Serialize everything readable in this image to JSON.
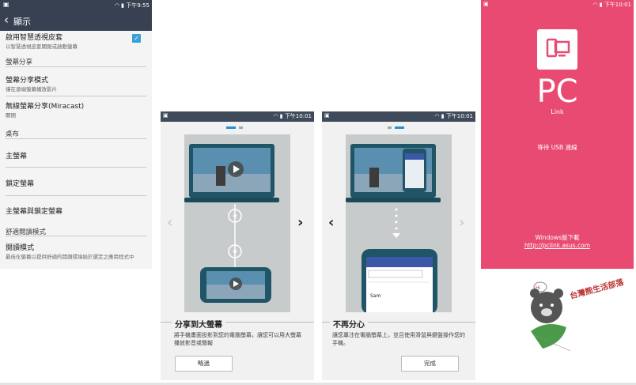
{
  "settings": {
    "status_time": "下午9:55",
    "title": "顯示",
    "smart_cover_title": "啟用智慧透視皮套",
    "smart_cover_sub": "以智慧透視皮套關閉或啟動螢幕",
    "section_share": "螢幕分享",
    "share_mode_title": "螢幕分享模式",
    "share_mode_sub": "僅在遠端螢幕播放影片",
    "miracast_title": "無線螢幕分享(Miracast)",
    "miracast_sub": "關閉",
    "section_wallpaper": "桌布",
    "home_screen": "主螢幕",
    "lock_screen": "鎖定螢幕",
    "home_and_lock": "主螢幕與鎖定螢幕",
    "section_reading": "舒適閱讀模式",
    "reading_title": "閱讀模式",
    "reading_sub": "最佳化螢幕以提供舒適的閱讀環境給於選定之應用程式中"
  },
  "onboard1": {
    "status_time": "下午10:01",
    "heading": "分享到大螢幕",
    "body": "將手機畫面投影到您的電腦螢幕，讓您可以用大螢幕播放影音或簡報",
    "button": "略過"
  },
  "onboard2": {
    "status_time": "下午10:01",
    "heading": "不再分心",
    "body": "讓您專注在電腦螢幕上，並且使用滑鼠與鍵盤操作您的手機。",
    "button": "完成",
    "phone_input_value": "Sam"
  },
  "pclink": {
    "status_time": "下午10:01",
    "logo_big": "PC",
    "logo_small": "Link",
    "waiting": "等待 USB 連線",
    "download_label": "Windows版下載",
    "download_link": "http://pclink.asus.com"
  },
  "watermark": {
    "text": "台灣熊生活部落"
  },
  "colors": {
    "settings_bar": "#374152",
    "pink": "#e84a72",
    "accent_blue": "#2a8fd0",
    "dark_teal": "#1f5566"
  }
}
